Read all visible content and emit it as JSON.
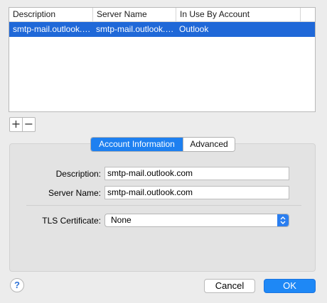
{
  "table": {
    "columns": [
      "Description",
      "Server Name",
      "In Use By Account"
    ],
    "rows": [
      {
        "description": "smtp-mail.outlook.…",
        "server_name": "smtp-mail.outlook.…",
        "in_use_by": "Outlook",
        "selected": true
      }
    ]
  },
  "list_controls": {
    "add_symbol": "+",
    "remove_symbol": "−"
  },
  "tabs": [
    {
      "label": "Account Information",
      "active": true
    },
    {
      "label": "Advanced",
      "active": false
    }
  ],
  "form": {
    "description_label": "Description:",
    "description_value": "smtp-mail.outlook.com",
    "server_name_label": "Server Name:",
    "server_name_value": "smtp-mail.outlook.com",
    "tls_label": "TLS Certificate:",
    "tls_value": "None"
  },
  "buttons": {
    "help": "?",
    "cancel": "Cancel",
    "ok": "OK"
  },
  "colors": {
    "selection": "#1f68d8",
    "accent": "#1e80f0",
    "window_bg": "#ececec"
  },
  "icons": {
    "popup_arrows": "updown-chevron-icon",
    "help": "question-mark-icon",
    "add": "plus-icon",
    "remove": "minus-icon"
  }
}
